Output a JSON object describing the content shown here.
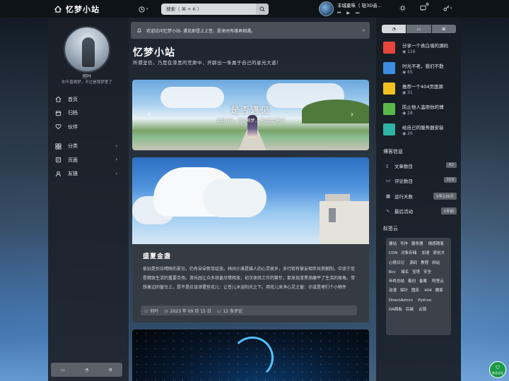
{
  "header": {
    "site_name": "忆梦小站",
    "search_placeholder": "搜索（ ⌘ + K ）",
    "song": "丰城夏味（ 轻3D音...",
    "msg_badge": "0"
  },
  "sidebar": {
    "user_name": "何叶",
    "signature": "你不曾做梦，不过是我梦里了",
    "items": [
      {
        "label": "首页",
        "icon": "home-icon"
      },
      {
        "label": "归档",
        "icon": "archive-icon"
      },
      {
        "label": "伙伴",
        "icon": "heart-icon"
      },
      {
        "label": "分类",
        "icon": "category-icon"
      },
      {
        "label": "页面",
        "icon": "page-icon"
      },
      {
        "label": "友链",
        "icon": "user-icon"
      }
    ]
  },
  "main": {
    "notice": "欢迎访问忆梦小站- 遇见即是上上签，愿来时有缘再相遇。",
    "site_title": "忆梦小站",
    "site_desc": "所谓坚信，乃是在漆黑的荒原中，开辟出一条属于自己的星光大道！",
    "banner": {
      "title": "是否遇见",
      "subtitle": "如日方升，不如萌梦，坚持那点星光"
    },
    "post": {
      "title": "盛夏金盏",
      "body": "依旧是烈日晴映的夏日，仍有朵朵新芽绽放。林间小溪是猫人的心灵故乡，多行街有掌友相伴共赏朝阳，中流宁足是精致生活的重要合场。游乐园让众多孩童尽情释放，初次体验工作的繁忙，那发现漆黑渐磨平了生活的棱角。常想桌边的窗台上，是不是应该添置些花儿：让苍儿沐浴阳光之下。用花儿来净心灵之窗：亦或是埋们个小物件",
      "author": "何叶",
      "date": "2023 年 09 月 15 日",
      "comments": "12 条评论"
    }
  },
  "right": {
    "tabs": [
      "hot-icon",
      "comment-icon",
      "gift-icon"
    ],
    "hot": [
      {
        "title": "分享一个表白墙的源码",
        "views": "116",
        "color": "#e8463c"
      },
      {
        "title": "时光不老，我们不散",
        "views": "65",
        "color": "#3d8de0"
      },
      {
        "title": "推荐一个404页面源",
        "views": "31",
        "color": "#f0c020"
      },
      {
        "title": "防止他人滥用你的博",
        "views": "28",
        "color": "#58b84a"
      },
      {
        "title": "给自己的服务器安装",
        "views": "26",
        "color": "#2fb3a5"
      }
    ],
    "info_title": "博客信息",
    "stats": [
      {
        "label": "文章数目",
        "value": "62",
        "icon": "doc-icon"
      },
      {
        "label": "评论数目",
        "value": "119",
        "icon": "comment-icon"
      },
      {
        "label": "运行天数",
        "value": "5年226天",
        "icon": "calendar-icon"
      },
      {
        "label": "最后活动",
        "value": "1年前",
        "icon": "pulse-icon"
      }
    ],
    "tags_title": "标签云",
    "tags": [
      "建站",
      "写作",
      "服务器",
      "情感随笔",
      "CDN",
      "对象存储",
      "加速",
      "原创文",
      "心情日记",
      "源码",
      "教程",
      "网站",
      "Bcc",
      "域名",
      "宝塔",
      "安全",
      "年终总结",
      "着创",
      "备案",
      "阿里云",
      "动漫",
      "探针",
      "图床",
      "404",
      "搬家",
      "DirectAdmin",
      "Python",
      "DA面板",
      "后端",
      "云锁"
    ]
  },
  "badge": {
    "line1": "安全",
    "line2": "安全认证"
  },
  "colors": {
    "topbar": "#0e1318",
    "panel": "#1c2128",
    "accent": "#1a9a46"
  }
}
